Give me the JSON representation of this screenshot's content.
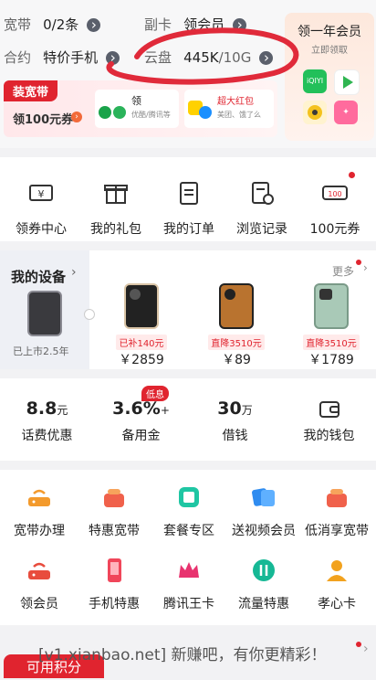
{
  "account": {
    "broadband_label": "宽带",
    "broadband_value": "0/2条",
    "subcard_label": "副卡",
    "subcard_value": "领会员",
    "contract_label": "合约",
    "contract_value": "特价手机",
    "cloud_label": "云盘",
    "cloud_used": "445K",
    "cloud_total": "/10G"
  },
  "member_promo": {
    "title": "领一年会员",
    "subtitle": "立即领取"
  },
  "broadband_banner": {
    "tag": "装宽带",
    "text": "领100元券",
    "offer1": "领",
    "offer1_sub": "优酷/腾讯等",
    "offer2": "超大红包",
    "offer2_sub": "美团、饿了么"
  },
  "quick_actions": [
    {
      "label": "领券中心",
      "icon": "coupon-icon"
    },
    {
      "label": "我的礼包",
      "icon": "gift-icon"
    },
    {
      "label": "我的订单",
      "icon": "order-icon"
    },
    {
      "label": "浏览记录",
      "icon": "history-icon"
    },
    {
      "label": "100元券",
      "icon": "voucher-icon",
      "badge": "100"
    }
  ],
  "devices": {
    "title": "我的设备",
    "more": "更多",
    "current": {
      "caption": "已上市2.5年"
    },
    "items": [
      {
        "promo": "已补140元",
        "price": "￥2859"
      },
      {
        "promo": "直降3510元",
        "price": "￥89"
      },
      {
        "promo": "直降3510元",
        "price": "￥1789"
      }
    ]
  },
  "finance": [
    {
      "value": "8.8",
      "unit": "元",
      "label": "话费优惠"
    },
    {
      "value": "3.6%",
      "unit": "+",
      "label": "备用金",
      "badge": "低息"
    },
    {
      "value": "30",
      "unit": "万",
      "label": "借钱"
    },
    {
      "value": "",
      "unit": "",
      "label": "我的钱包",
      "icon": "wallet-icon"
    }
  ],
  "services": [
    {
      "label": "宽带办理",
      "icon": "router-icon",
      "color": "#f39a2c"
    },
    {
      "label": "特惠宽带",
      "icon": "basket-icon",
      "color": "#f0614b"
    },
    {
      "label": "套餐专区",
      "icon": "package-icon",
      "color": "#1fc6a3"
    },
    {
      "label": "送视频会员",
      "icon": "video-icon",
      "color": "#2f8cf0"
    },
    {
      "label": "低消享宽带",
      "icon": "basket-icon",
      "color": "#f0614b"
    },
    {
      "label": "领会员",
      "icon": "router-icon",
      "color": "#e84c3d"
    },
    {
      "label": "手机特惠",
      "icon": "phone-icon",
      "color": "#f0465a"
    },
    {
      "label": "腾讯王卡",
      "icon": "crown-icon",
      "color": "#e8336f"
    },
    {
      "label": "流量特惠",
      "icon": "data-icon",
      "color": "#16b895"
    },
    {
      "label": "孝心卡",
      "icon": "person-icon",
      "color": "#f2a21e"
    }
  ],
  "footer": {
    "watermark": "[v1.xianbao.net] 新赚吧，有你更精彩！",
    "button": "可用积分"
  },
  "colors": {
    "accent": "#e0242f",
    "annotation": "#e02a3a"
  }
}
